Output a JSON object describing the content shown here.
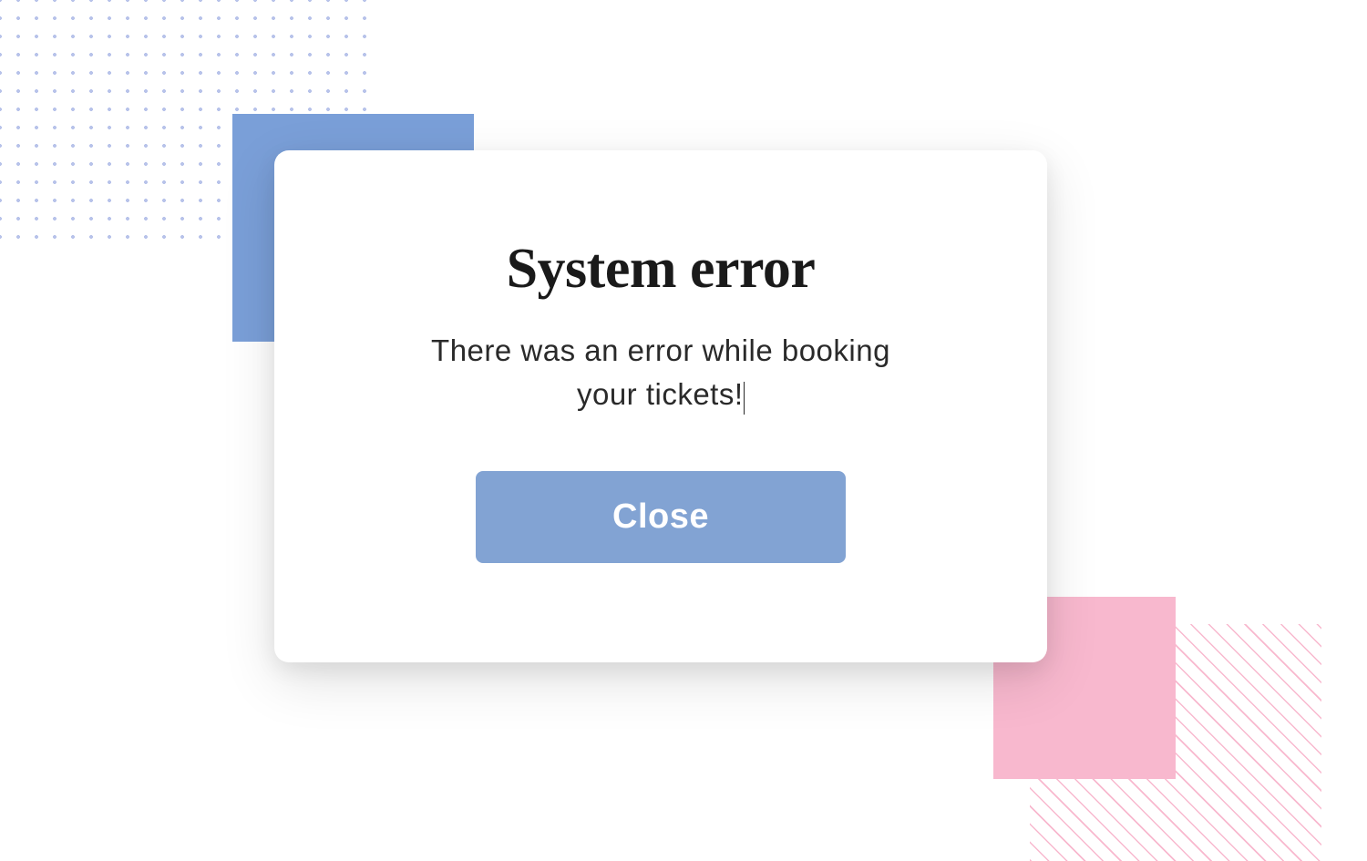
{
  "modal": {
    "title": "System error",
    "message": "There was an error while booking your tickets!",
    "close_label": "Close"
  },
  "colors": {
    "accent_blue": "#82a3d3",
    "decoration_blue": "#7a9fd8",
    "decoration_pink": "#f8b8ce",
    "dot_color": "#b8c3ea"
  }
}
